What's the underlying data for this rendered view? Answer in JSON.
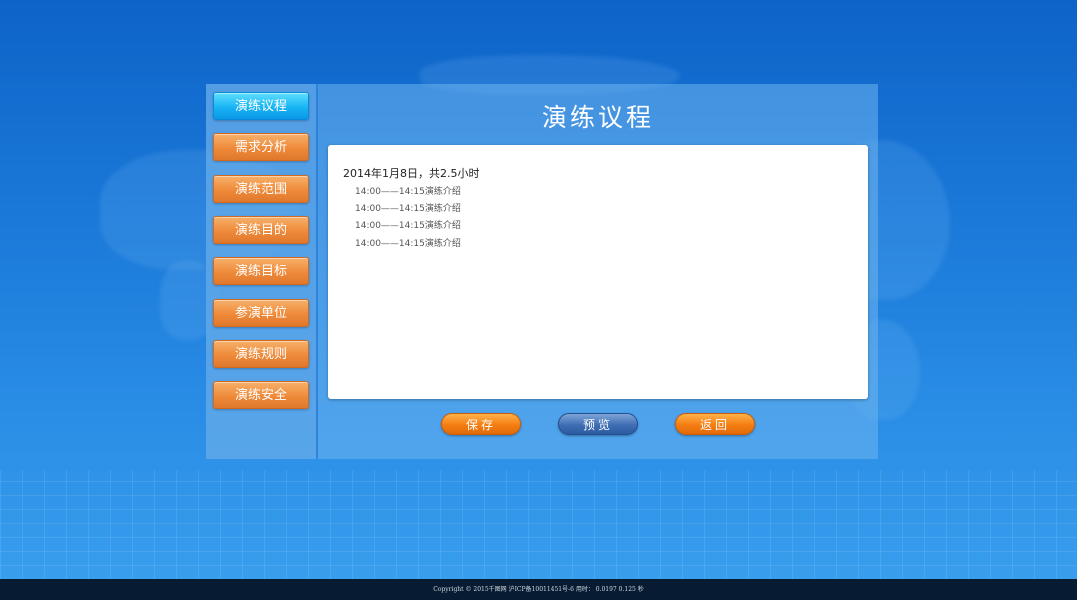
{
  "sidebar": {
    "items": [
      {
        "label": "演练议程",
        "active": true
      },
      {
        "label": "需求分析",
        "active": false
      },
      {
        "label": "演练范围",
        "active": false
      },
      {
        "label": "演练目的",
        "active": false
      },
      {
        "label": "演练目标",
        "active": false
      },
      {
        "label": "参演单位",
        "active": false
      },
      {
        "label": "演练规则",
        "active": false
      },
      {
        "label": "演练安全",
        "active": false
      }
    ]
  },
  "main": {
    "title": "演练议程",
    "agenda": {
      "date_line": "2014年1月8日，共2.5小时",
      "items": [
        "14:00——14:15演练介绍",
        "14:00——14:15演练介绍",
        "14:00——14:15演练介绍",
        "14:00——14:15演练介绍"
      ]
    },
    "actions": {
      "save_label": "保存",
      "preview_label": "预览",
      "back_label": "返回"
    }
  },
  "footer": {
    "text": "Copyright © 2015千图网 沪ICP备10011451号-6 用时： 0.0197 0.125 秒"
  },
  "colors": {
    "background": "#1a78d8",
    "active_button": "#18b4f4",
    "orange_button": "#ef8a3a",
    "blue_button": "#3f6eb4",
    "footer_bg": "#071c33"
  }
}
